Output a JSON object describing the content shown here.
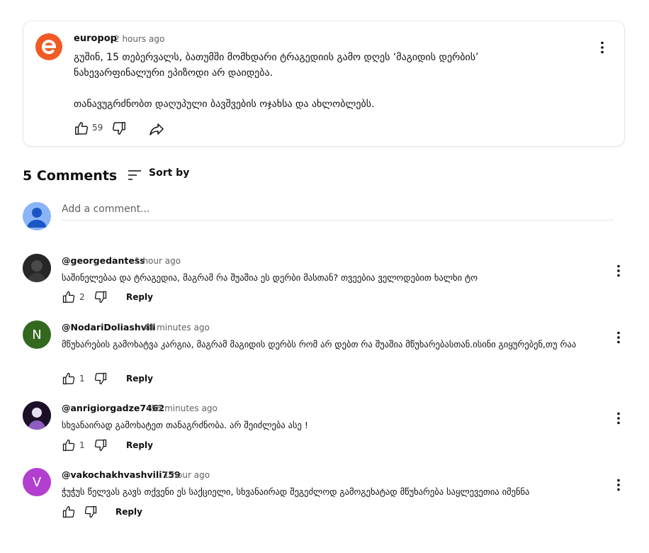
{
  "post": {
    "author": "europop",
    "time": "2 hours ago",
    "paragraph1": "გუშინ, 15 თებერვალს, ბათუმში მომხდარი ტრაგედიის გამო დღეს ‘მაგიდის დერბის’ ნახევარფინალური ეპიზოდი არ დაიდება.",
    "paragraph2": "თანავუგრძნობთ დაღუპული ბავშვების ოჯახსა და ახლობლებს.",
    "likes": "59",
    "logo_color": "#f15a24"
  },
  "comments_header": {
    "count_label": "5 Comments",
    "sort_label": "Sort by"
  },
  "add_comment": {
    "placeholder": "Add a comment..."
  },
  "reply_label": "Reply",
  "comments": [
    {
      "author": "@georgedantess",
      "time": "1 hour ago",
      "text": "საშინელებაა და ტრაგედია, მაგრამ რა შუაშია ეს დერბი მასთან? თვეებია ველოდებით ხალხი ტო",
      "likes": "2",
      "avatar_letter": "",
      "avatar_color": "#2a2a2a"
    },
    {
      "author": "@NodariDoliashvili",
      "time": "48 minutes ago",
      "text": "მწუხარების გამოხატვა კარგია, მაგრამ მაგიდის დერბს რომ არ დებთ რა შუაშია მწუხარებასთან.ისინი გიყურებენ,თუ რაა",
      "likes": "1",
      "avatar_letter": "N",
      "avatar_color": "#33691e"
    },
    {
      "author": "@anrigiorgadze7462",
      "time": "58 minutes ago",
      "text": "სხვანაირად გამოხატეთ თანაგრძნობა. არ შეიძლება ასე !",
      "likes": "1",
      "avatar_letter": "",
      "avatar_color": "#3a1f4f"
    },
    {
      "author": "@vakochakhvashvili759",
      "time": "1 hour ago",
      "text": "ჭუჭუს წელვას გავს თქვენი ეს საქციელი, სხვანაირად შეგეძლოდ გამოგეხატად მწუხარება  საყლევეთია იმენნა",
      "likes": "",
      "avatar_letter": "V",
      "avatar_color": "#b23fd0"
    }
  ]
}
